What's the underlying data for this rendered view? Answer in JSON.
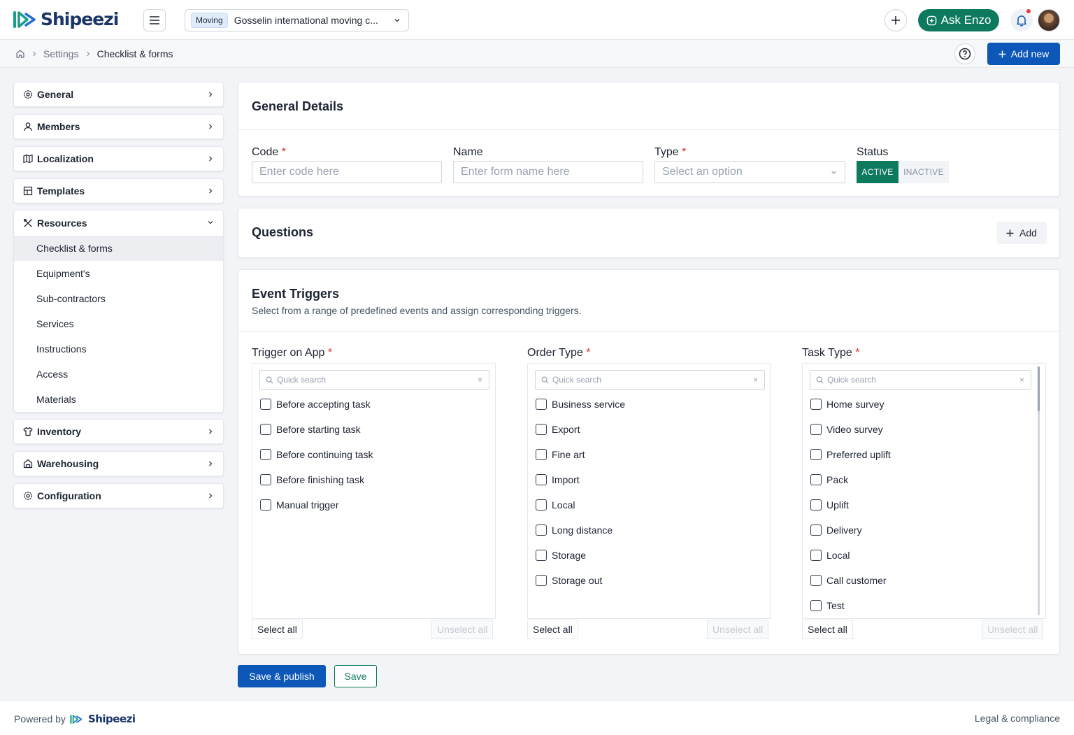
{
  "app": {
    "name": "Shipeezi",
    "brand_color": "#1a3567",
    "accent": "#0d7a5f",
    "primary": "#0c57b8"
  },
  "topbar": {
    "company_badge": "Moving",
    "company_name": "Gosselin international moving c...",
    "ask_label": "Ask Enzo"
  },
  "breadcrumb": {
    "settings": "Settings",
    "current": "Checklist & forms"
  },
  "actions": {
    "add_new": "Add new"
  },
  "sidebar": {
    "general": "General",
    "members": "Members",
    "localization": "Localization",
    "templates": "Templates",
    "resources": "Resources",
    "resources_items": [
      "Checklist & forms",
      "Equipment's",
      "Sub-contractors",
      "Services",
      "Instructions",
      "Access",
      "Materials"
    ],
    "inventory": "Inventory",
    "warehousing": "Warehousing",
    "configuration": "Configuration"
  },
  "general_details": {
    "title": "General Details",
    "code_label": "Code",
    "code_placeholder": "Enter code here",
    "name_label": "Name",
    "name_placeholder": "Enter form name here",
    "type_label": "Type",
    "type_placeholder": "Select an option",
    "status_label": "Status",
    "status_active": "ACTIVE",
    "status_inactive": "INACTIVE",
    "required_mark": "*"
  },
  "questions": {
    "title": "Questions",
    "add_label": "Add"
  },
  "event_triggers": {
    "title": "Event Triggers",
    "subtitle": "Select from a range of predefined events and assign corresponding triggers.",
    "search_placeholder": "Quick search",
    "clear_glyph": "×",
    "select_all": "Select all",
    "unselect_all": "Unselect all",
    "trigger_label": "Trigger on App",
    "trigger_options": [
      "Before accepting task",
      "Before starting task",
      "Before continuing task",
      "Before finishing task",
      "Manual trigger"
    ],
    "order_label": "Order Type",
    "order_options": [
      "Business service",
      "Export",
      "Fine art",
      "Import",
      "Local",
      "Long distance",
      "Storage",
      "Storage out"
    ],
    "task_label": "Task Type",
    "task_options": [
      "Home survey",
      "Video survey",
      "Preferred uplift",
      "Pack",
      "Uplift",
      "Delivery",
      "Local",
      "Call customer",
      "Test"
    ]
  },
  "footer_actions": {
    "publish": "Save & publish",
    "save": "Save"
  },
  "footer": {
    "powered_by": "Powered by",
    "brand": "Shipeezi",
    "legal": "Legal & compliance"
  }
}
